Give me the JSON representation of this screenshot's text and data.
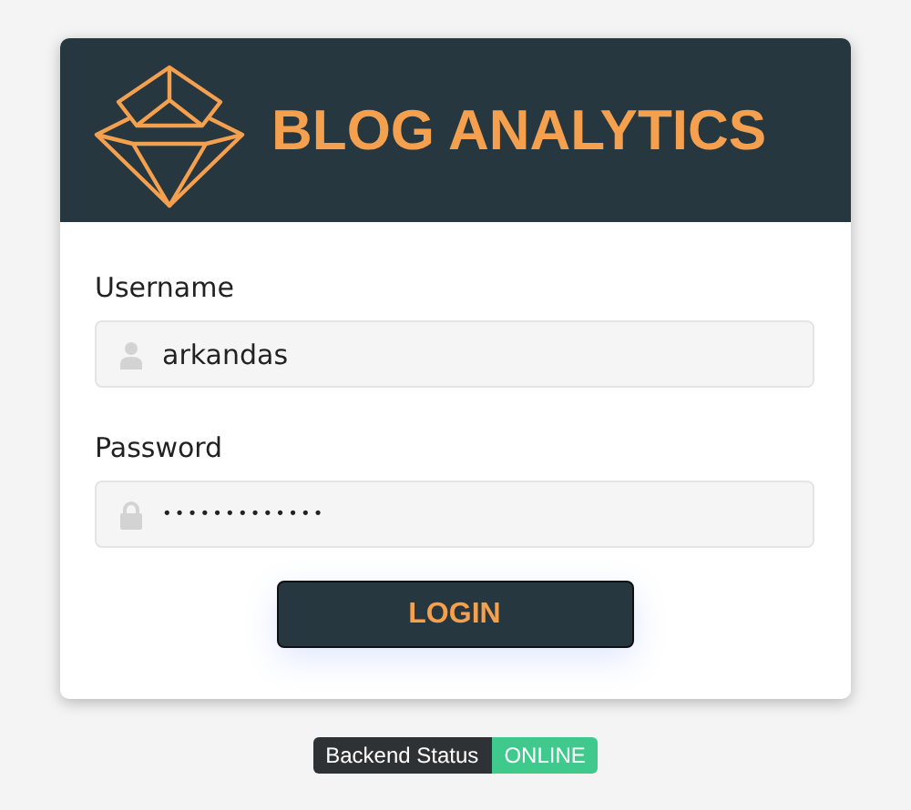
{
  "header": {
    "title": "BLOG ANALYTICS"
  },
  "fields": [
    {
      "label": "Username",
      "kind": "user",
      "value": "arkandas"
    },
    {
      "label": "Password",
      "kind": "lock",
      "value": "•••••••••••••"
    }
  ],
  "login_button": "LOGIN",
  "status": {
    "label": "Backend Status",
    "value": "ONLINE"
  }
}
